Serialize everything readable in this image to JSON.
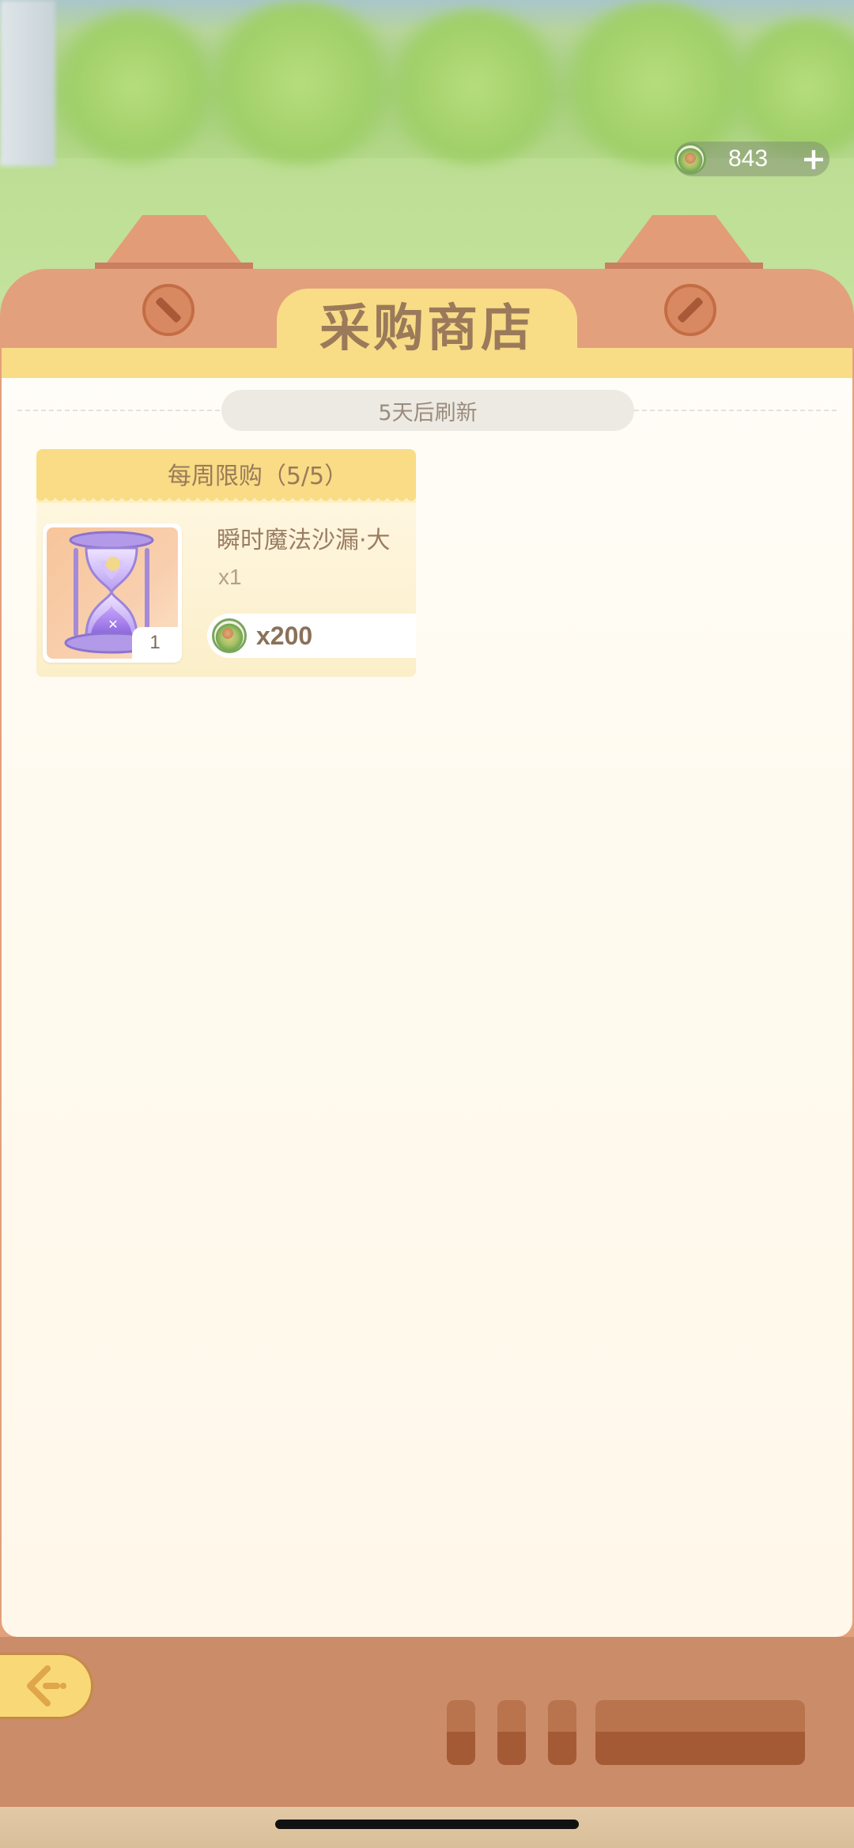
{
  "hud": {
    "currency_icon": "coin-icon",
    "currency_amount": "843",
    "add_symbol": "+"
  },
  "shop": {
    "title": "采购商店",
    "refresh_text": "5天后刷新"
  },
  "card": {
    "header": "每周限购（5/5）",
    "item_name": "瞬时魔法沙漏·大",
    "item_quantity": "x1",
    "thumb_count": "1",
    "price": "x200",
    "item_icon": "hourglass-icon"
  },
  "colors": {
    "frame": "#e3a07c",
    "tab": "#f8dc86",
    "panel": "#fffaef",
    "text_brown": "#9a7a5a"
  }
}
